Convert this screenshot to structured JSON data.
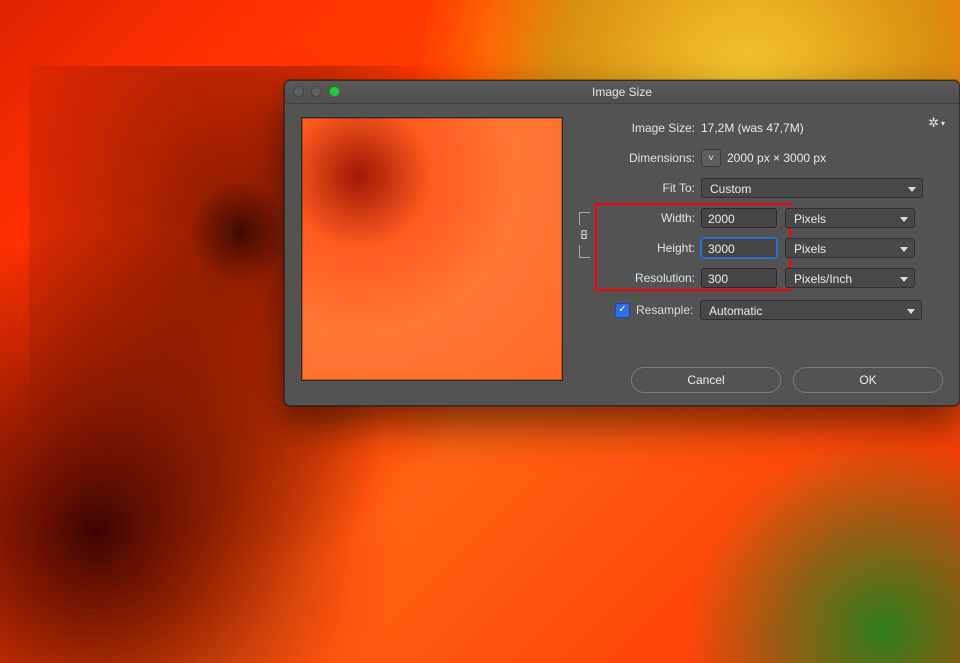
{
  "dialog": {
    "title": "Image Size",
    "imageSizeLabel": "Image Size:",
    "imageSizeValue": "17,2M (was 47,7M)",
    "dimensionsLabel": "Dimensions:",
    "dimensionsValue": "2000 px  ×  3000 px",
    "fitToLabel": "Fit To:",
    "fitToValue": "Custom",
    "widthLabel": "Width:",
    "widthValue": "2000",
    "widthUnit": "Pixels",
    "heightLabel": "Height:",
    "heightValue": "3000",
    "heightUnit": "Pixels",
    "resolutionLabel": "Resolution:",
    "resolutionValue": "300",
    "resolutionUnit": "Pixels/Inch",
    "resampleLabel": "Resample:",
    "resampleValue": "Automatic",
    "cancelLabel": "Cancel",
    "okLabel": "OK"
  }
}
